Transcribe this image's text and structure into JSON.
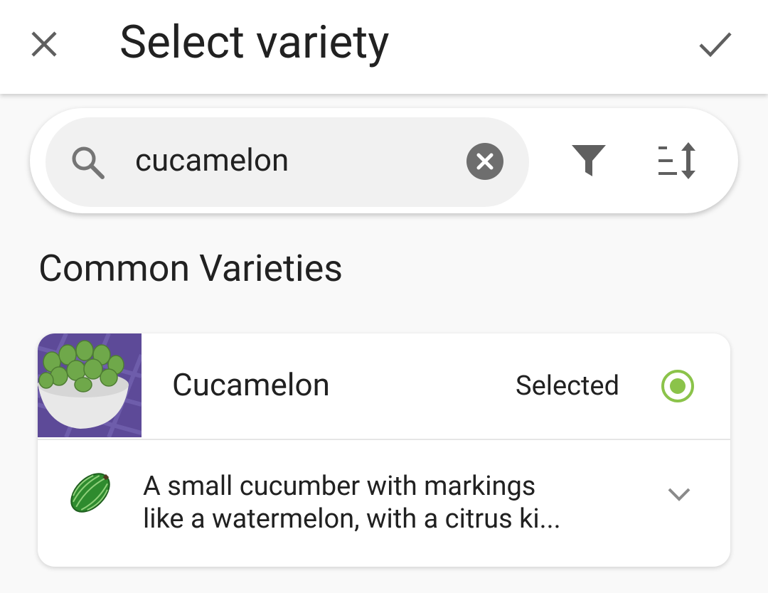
{
  "appbar": {
    "title": "Select variety",
    "close_icon": "close-icon",
    "confirm_icon": "check-icon"
  },
  "search": {
    "value": "cucamelon",
    "icon": "search-icon",
    "clear_icon": "clear-circle-icon",
    "filter_icon": "filter-icon",
    "sort_icon": "sort-icon"
  },
  "section": {
    "title": "Common Varieties"
  },
  "variety": {
    "name": "Cucamelon",
    "status": "Selected",
    "description_line1": "A small cucumber with markings",
    "description_line2": "like a watermelon, with a citrus ki...",
    "accent_color": "#8bc34a",
    "expand_icon": "chevron-down-icon"
  }
}
